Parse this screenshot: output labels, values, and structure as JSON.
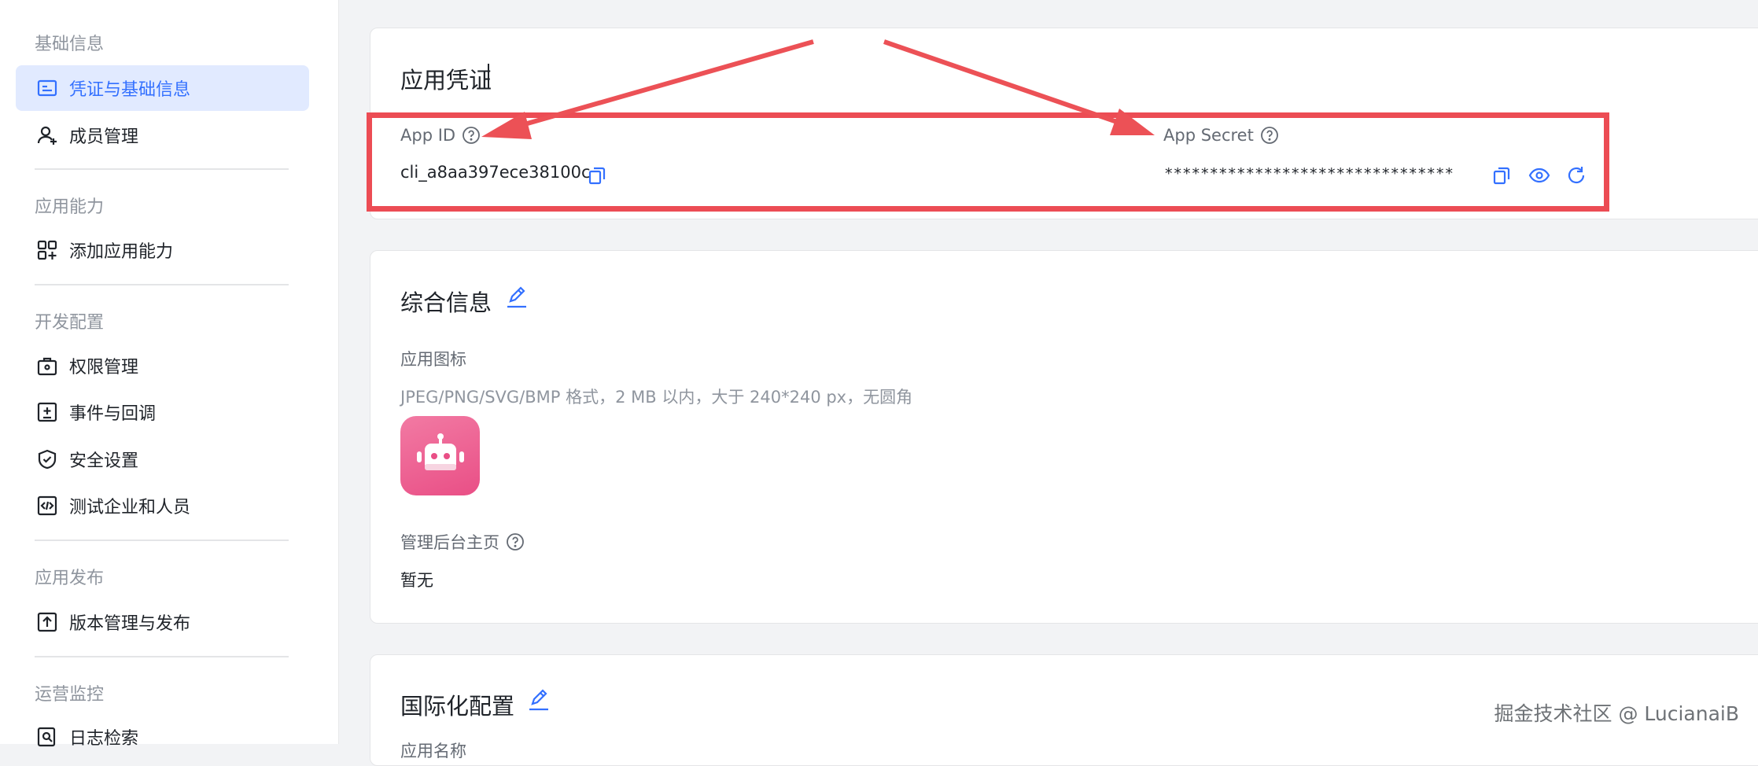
{
  "sidebar": {
    "groups": [
      {
        "title": "基础信息",
        "items": [
          {
            "label": "凭证与基础信息",
            "icon": "credential-icon",
            "active": true
          },
          {
            "label": "成员管理",
            "icon": "member-icon"
          }
        ]
      },
      {
        "title": "应用能力",
        "items": [
          {
            "label": "添加应用能力",
            "icon": "add-capability-icon"
          }
        ]
      },
      {
        "title": "开发配置",
        "items": [
          {
            "label": "权限管理",
            "icon": "permission-icon"
          },
          {
            "label": "事件与回调",
            "icon": "event-callback-icon"
          },
          {
            "label": "安全设置",
            "icon": "shield-icon"
          },
          {
            "label": "测试企业和人员",
            "icon": "test-code-icon"
          }
        ]
      },
      {
        "title": "应用发布",
        "items": [
          {
            "label": "版本管理与发布",
            "icon": "upload-icon"
          }
        ]
      },
      {
        "title": "运营监控",
        "items": [
          {
            "label": "日志检索",
            "icon": "log-search-icon"
          }
        ]
      }
    ]
  },
  "credentials": {
    "title": "应用凭证",
    "app_id_label": "App ID",
    "app_id_value": "cli_a8aa397ece38100c",
    "app_secret_label": "App Secret",
    "app_secret_value": "********************************"
  },
  "general": {
    "title": "综合信息",
    "icon_label": "应用图标",
    "icon_hint": "JPEG/PNG/SVG/BMP 格式，2 MB 以内，大于 240*240 px，无圆角",
    "homepage_label": "管理后台主页",
    "homepage_value": "暂无"
  },
  "i18n": {
    "title": "国际化配置",
    "name_label": "应用名称"
  },
  "watermark": "掘金技术社区 @ LucianaiB",
  "colors": {
    "accent": "#3370ff",
    "highlight": "#ec4c54",
    "app_icon": "#e94f86"
  }
}
